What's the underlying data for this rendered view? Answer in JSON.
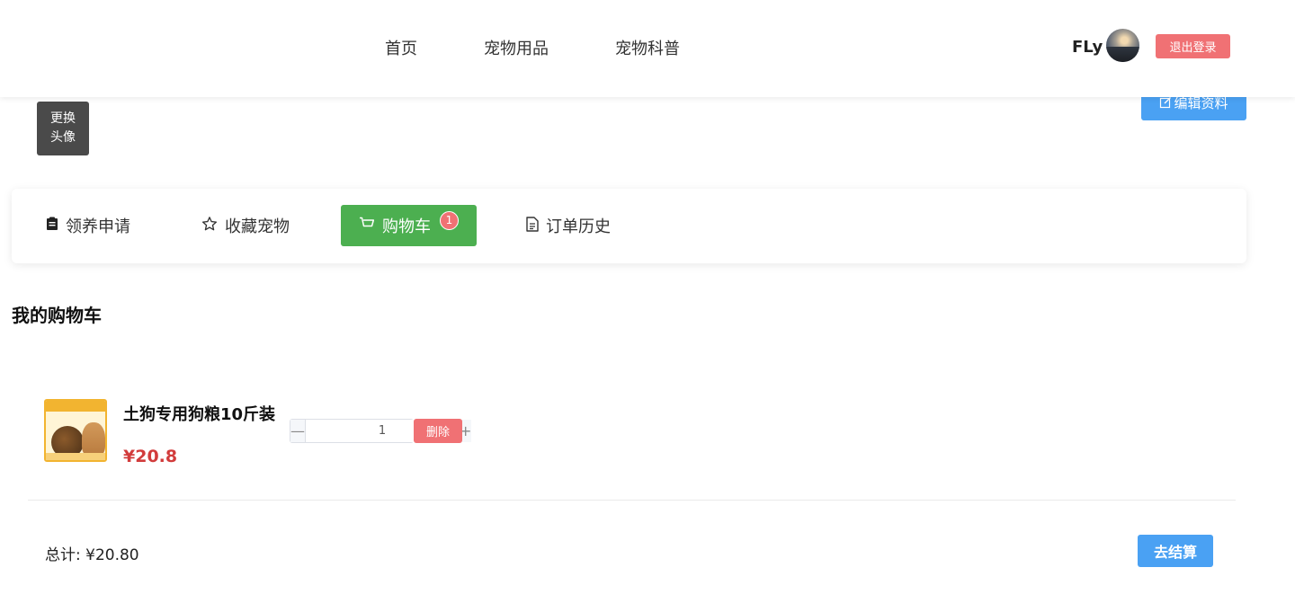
{
  "header": {
    "nav": [
      "首页",
      "宠物用品",
      "宠物科普"
    ],
    "user_name": "FLy",
    "logout_label": "退出登录"
  },
  "profile": {
    "change_avatar_label": "更换\n头像",
    "edit_label": "编辑资料"
  },
  "tabs": [
    {
      "label": "领养申请",
      "icon": "clipboard-icon"
    },
    {
      "label": "收藏宠物",
      "icon": "star-icon"
    },
    {
      "label": "购物车",
      "icon": "cart-icon",
      "badge": "1",
      "active": true
    },
    {
      "label": "订单历史",
      "icon": "document-icon"
    }
  ],
  "cart": {
    "title": "我的购物车",
    "items": [
      {
        "name": "土狗专用狗粮10斤装",
        "price": "¥20.8",
        "quantity": "1",
        "delete_label": "删除"
      }
    ],
    "total_label": "总计: ¥20.80",
    "checkout_label": "去结算"
  },
  "colors": {
    "accent_blue": "#4aa1f3",
    "active_tab_green": "#4caf50",
    "danger_red": "#f07174",
    "price_red": "#d23c3c"
  }
}
